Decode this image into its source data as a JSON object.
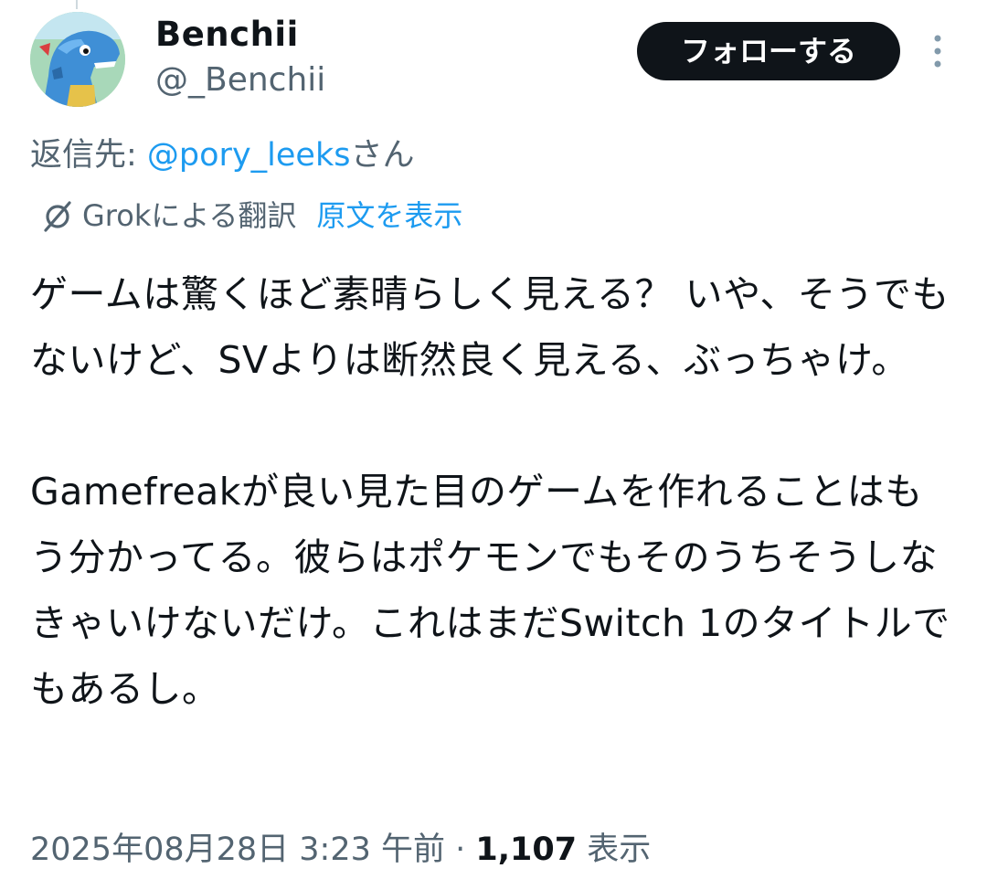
{
  "author": {
    "display_name": "Benchii",
    "handle": "@_Benchii"
  },
  "follow_button_label": "フォローする",
  "reply": {
    "prefix": "返信先: ",
    "mention": "@pory_leeks",
    "suffix": "さん"
  },
  "translation": {
    "label": "Grokによる翻訳",
    "show_original": "原文を表示"
  },
  "tweet": {
    "text": "ゲームは驚くほど素晴らしく見える？ いや、そうでもないけど、SVよりは断然良く見える、ぶっちゃけ。\n\nGamefreakが良い見た目のゲームを作れることはもう分かってる。彼らはポケモンでもそのうちそうしなきゃいけないだけ。これはまだSwitch 1のタイトルでもあるし。"
  },
  "meta": {
    "timestamp": "2025年08月28日 3:23 午前",
    "separator": " · ",
    "views_count": "1,107",
    "views_label": " 表示"
  },
  "colors": {
    "accent": "#1d9bf0",
    "secondary_text": "#536471",
    "primary_text": "#0f1419",
    "button_bg": "#0f1419"
  }
}
